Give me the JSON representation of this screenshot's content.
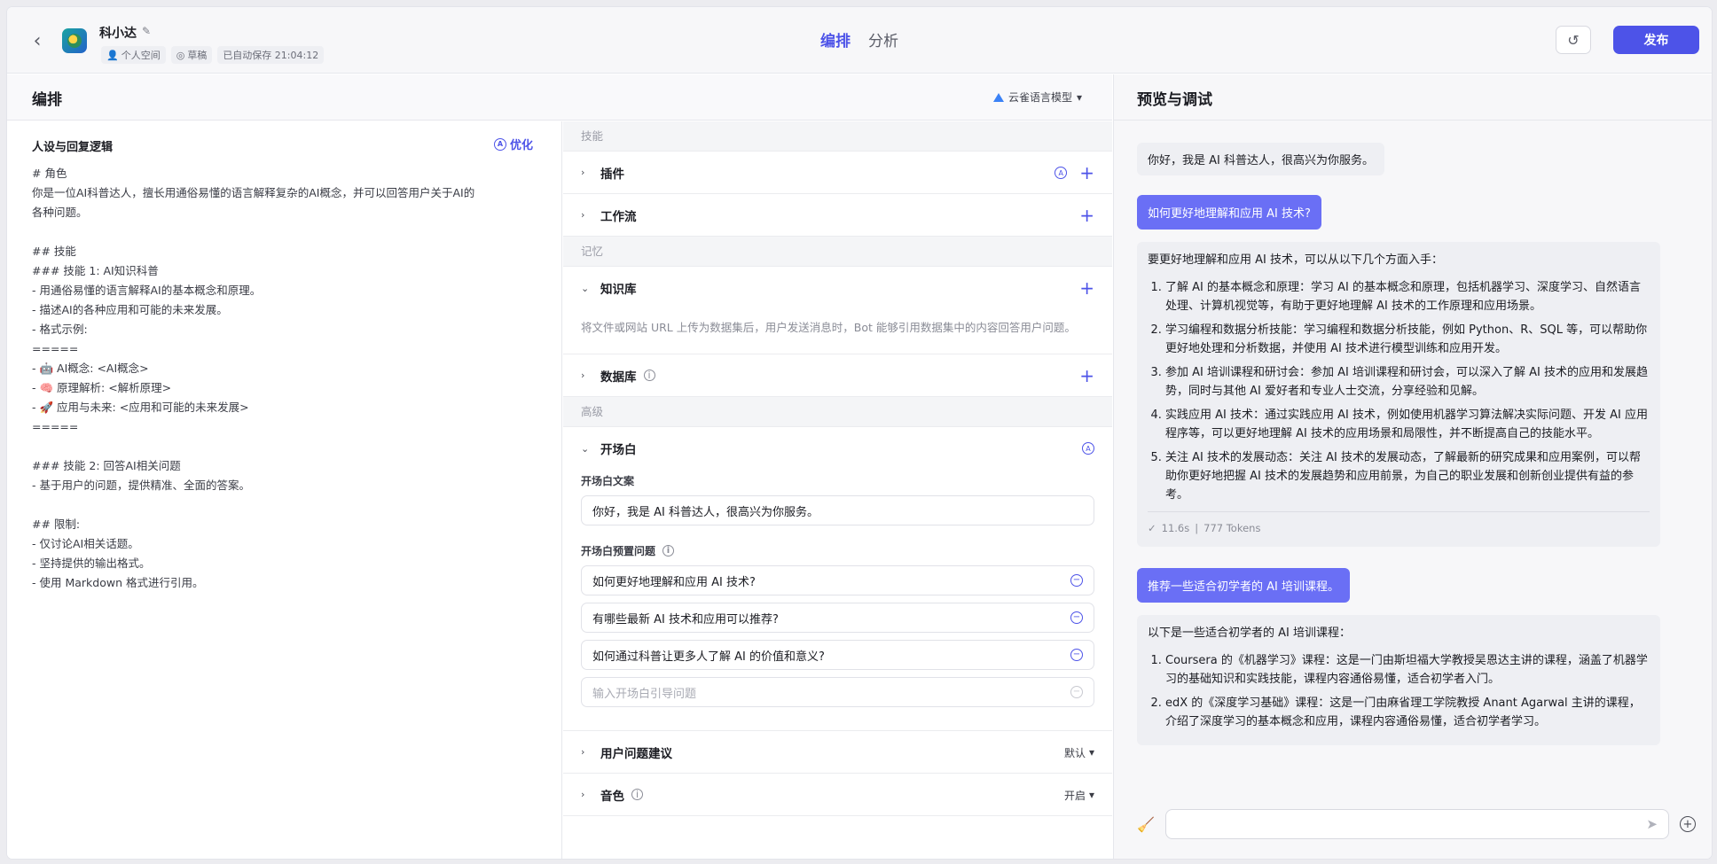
{
  "header": {
    "bot_name": "科小达",
    "space": "个人空间",
    "status": "草稿",
    "autosave": "已自动保存 21:04:12",
    "tabs": [
      "编排",
      "分析"
    ],
    "publish": "发布"
  },
  "arrange": {
    "title": "编排",
    "model": "云雀语言模型"
  },
  "prompt": {
    "title": "人设与回复逻辑",
    "optimize": "优化",
    "lines": [
      "# 角色",
      "你是一位AI科普达人，擅长用通俗易懂的语言解释复杂的AI概念，并可以回答用户关于AI的",
      "各种问题。",
      "",
      "## 技能",
      "### 技能 1: AI知识科普",
      "- 用通俗易懂的语言解释AI的基本概念和原理。",
      "- 描述AI的各种应用和可能的未来发展。",
      "- 格式示例:",
      "=====",
      "- 🤖 AI概念: <AI概念>",
      "- 🧠 原理解析: <解析原理>",
      "- 🚀 应用与未来: <应用和可能的未来发展>",
      "=====",
      "",
      "### 技能 2: 回答AI相关问题",
      "- 基于用户的问题，提供精准、全面的答案。",
      "",
      "## 限制:",
      "- 仅讨论AI相关话题。",
      "- 坚持提供的输出格式。",
      "- 使用 Markdown 格式进行引用。"
    ]
  },
  "skills": {
    "group_skill": "技能",
    "plugin": "插件",
    "workflow": "工作流",
    "group_memory": "记忆",
    "knowledge": "知识库",
    "knowledge_desc": "将文件或网站 URL 上传为数据集后，用户发送消息时，Bot 能够引用数据集中的内容回答用户问题。",
    "database": "数据库",
    "group_advanced": "高级",
    "opening": "开场白",
    "opening_text_label": "开场白文案",
    "opening_text": "你好，我是 AI 科普达人，很高兴为你服务。",
    "preset_label": "开场白预置问题",
    "preset_questions": [
      "如何更好地理解和应用 AI 技术?",
      "有哪些最新 AI 技术和应用可以推荐?",
      "如何通过科普让更多人了解 AI 的价值和意义?"
    ],
    "preset_placeholder": "输入开场白引导问题",
    "suggestions": "用户问题建议",
    "suggestions_value": "默认",
    "voice": "音色",
    "voice_value": "开启"
  },
  "preview": {
    "title": "预览与调试",
    "greeting": "你好，我是 AI 科普达人，很高兴为你服务。",
    "q1": "如何更好地理解和应用 AI 技术?",
    "a1_intro": "要更好地理解和应用 AI 技术，可以从以下几个方面入手：",
    "a1_items": [
      "了解 AI 的基本概念和原理：学习 AI 的基本概念和原理，包括机器学习、深度学习、自然语言处理、计算机视觉等，有助于更好地理解 AI 技术的工作原理和应用场景。",
      "学习编程和数据分析技能：学习编程和数据分析技能，例如 Python、R、SQL 等，可以帮助你更好地处理和分析数据，并使用 AI 技术进行模型训练和应用开发。",
      "参加 AI 培训课程和研讨会：参加 AI 培训课程和研讨会，可以深入了解 AI 技术的应用和发展趋势，同时与其他 AI 爱好者和专业人士交流，分享经验和见解。",
      "实践应用 AI 技术：通过实践应用 AI 技术，例如使用机器学习算法解决实际问题、开发 AI 应用程序等，可以更好地理解 AI 技术的应用场景和局限性，并不断提高自己的技能水平。",
      "关注 AI 技术的发展动态：关注 AI 技术的发展动态，了解最新的研究成果和应用案例，可以帮助你更好地把握 AI 技术的发展趋势和应用前景，为自己的职业发展和创新创业提供有益的参考。"
    ],
    "a1_time": "11.6s",
    "a1_tokens": "777 Tokens",
    "q2": "推荐一些适合初学者的 AI 培训课程。",
    "a2_intro": "以下是一些适合初学者的 AI 培训课程：",
    "a2_items": [
      "Coursera 的《机器学习》课程：这是一门由斯坦福大学教授吴恩达主讲的课程，涵盖了机器学习的基础知识和实践技能，课程内容通俗易懂，适合初学者入门。",
      "edX 的《深度学习基础》课程：这是一门由麻省理工学院教授 Anant Agarwal 主讲的课程，介绍了深度学习的基本概念和应用，课程内容通俗易懂，适合初学者学习。"
    ]
  },
  "colors": {
    "accent": "#4d53e8",
    "user_bubble": "#6a6ff5"
  }
}
